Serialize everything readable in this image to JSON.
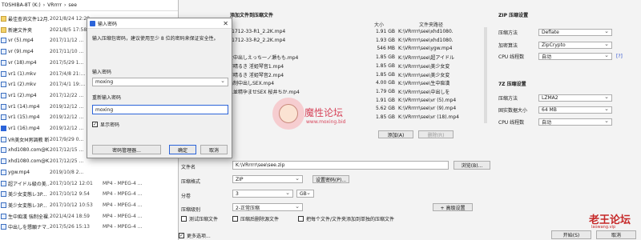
{
  "explorer": {
    "path": [
      "TOSHIBA-8T (K:)",
      "VRrrrr",
      "see"
    ],
    "files": [
      {
        "name": "最佳查询文件12月...",
        "date": "2021/8/24 12:28",
        "type": "",
        "icon": "folder"
      },
      {
        "name": "新建文件夹",
        "date": "2021/8/5 17:58",
        "type": "",
        "icon": "folder"
      },
      {
        "name": "vr (5).mp4",
        "date": "2017/11/12 ...",
        "type": "",
        "icon": "video"
      },
      {
        "name": "vr (9).mp4",
        "date": "2017/11/10 ...",
        "type": "",
        "icon": "video"
      },
      {
        "name": "vr (18).mp4",
        "date": "2017/5/29 1...",
        "type": "",
        "icon": "video"
      },
      {
        "name": "vr1 (1).mkv",
        "date": "2017/4/8 21:...",
        "type": "",
        "icon": "video"
      },
      {
        "name": "vr1 (2).mkv",
        "date": "2017/4/1 19:...",
        "type": "",
        "icon": "video"
      },
      {
        "name": "vr1 (2).mp4",
        "date": "2017/12/22 ...",
        "type": "",
        "icon": "video"
      },
      {
        "name": "vr1 (14).mp4",
        "date": "2019/12/12 ...",
        "type": "",
        "icon": "video"
      },
      {
        "name": "vr1 (15).mp4",
        "date": "2019/12/12 ...",
        "type": "",
        "icon": "video"
      },
      {
        "name": "vr1 (16).mp4",
        "date": "2019/12/12 ...",
        "type": "",
        "icon": "checked"
      },
      {
        "name": "VR美女M男調教 断...",
        "date": "2017/9/29 0...",
        "type": "",
        "icon": "video"
      },
      {
        "name": "xhd1080.com@K...",
        "date": "2017/12/15 ...",
        "type": "",
        "icon": "video"
      },
      {
        "name": "xhd1080.com@K...",
        "date": "2017/12/25 ...",
        "type": "",
        "icon": "video"
      },
      {
        "name": "ygw.mp4",
        "date": "2019/10/8 2...",
        "type": "",
        "icon": "video"
      },
      {
        "name": "超アイドル級の美...",
        "date": "2017/10/12 12:01",
        "type": "MP4 - MPEG-4 ...",
        "icon": "video"
      },
      {
        "name": "美少女変態レ3P...",
        "date": "2017/10/12 9:54",
        "type": "MP4 - MPEG-4 ...",
        "icon": "video"
      },
      {
        "name": "美少女変態レ3P...",
        "date": "2017/10/12 10:53",
        "type": "MP4 - MPEG-4 ...",
        "icon": "video"
      },
      {
        "name": "生中痴漢 強制全裸...",
        "date": "2021/4/24 18:59",
        "type": "MP4 - MPEG-4 ...",
        "icon": "video"
      },
      {
        "name": "中出しを懇願ナマ...",
        "date": "2017/5/26 15:13",
        "type": "MP4 - MPEG-4 ...",
        "icon": "video"
      }
    ]
  },
  "add": {
    "title": "添加文件到压缩文件",
    "col_size": "大小",
    "col_path": "文件夹路径",
    "rows": [
      {
        "name": "R1712-33-R1_2.2K.mp4",
        "size": "1.91 GB",
        "path": "K:\\VRrrrr\\see\\xhd1080."
      },
      {
        "name": "R1712-33-R2_2.2K.mp4",
        "size": "1.93 GB",
        "path": "K:\\VRrrrr\\see\\xhd1080."
      },
      {
        "name": "",
        "size": "546 MB",
        "path": "K:\\VRrrrr\\see\\ygw.mp4"
      },
      {
        "name": "女中出しえっち一ノ瀬もも.mp4",
        "size": "1.85 GB",
        "path": "K:\\VRrrrr\\see\\超アイドル"
      },
      {
        "name": "市晴るき 淫姫琴音1.mp4",
        "size": "1.85 GB",
        "path": "K:\\VRrrrr\\see\\美少女変"
      },
      {
        "name": "市晴るき 淫姫琴音2.mp4",
        "size": "1.85 GB",
        "path": "K:\\VRrrrr\\see\\美少女変"
      },
      {
        "name": "強制中出しSEX.mp4",
        "size": "4.00 GB",
        "path": "K:\\VRrrrr\\see\\生中痴漢"
      },
      {
        "name": "人並精孕ませSEX 桜井ちか.mp4",
        "size": "1.79 GB",
        "path": "K:\\VRrrrr\\see\\中出しを"
      },
      {
        "name": "",
        "size": "1.91 GB",
        "path": "K:\\VRrrrr\\see\\vr (5).mp4"
      },
      {
        "name": "",
        "size": "5.62 GB",
        "path": "K:\\VRrrrr\\see\\vr (9).mp4"
      },
      {
        "name": "",
        "size": "1.85 GB",
        "path": "K:\\VRrrrr\\see\\vr (18).mp4"
      }
    ],
    "add_btn": "添加(A)",
    "remove_btn": "删除(R)",
    "filename_label": "文件名",
    "filename_value": "K:\\VRrrrr\\see\\see.zip",
    "browse_btn": "浏览(B)...",
    "format_label": "压缩格式",
    "format_value": "ZIP",
    "setpw_btn": "设置密码(P)...",
    "volume_label": "分卷",
    "volume_value": "3",
    "volume_unit": "GB",
    "level_label": "压缩级别",
    "level_value": "2-正常压缩",
    "advanced_btn": "+ 高级设置",
    "opt_test": "测试压缩文件",
    "opt_delete": "压缩后删除源文件",
    "opt_each": "把每个文件/文件夹添加到单独的压缩文件",
    "more_options": "更多选项...",
    "start_btn": "开始(S)",
    "cancel_btn": "取消"
  },
  "zip": {
    "title": "ZIP 压缩设置",
    "method_label": "压缩方法",
    "method_value": "Deflate",
    "encrypt_label": "加密算法",
    "encrypt_value": "ZipCrypto",
    "cpu_label": "CPU 线程数",
    "cpu_value": "自动",
    "help": "[?]"
  },
  "sevenz": {
    "title": "7Z 压缩设置",
    "method_label": "压缩方法",
    "method_value": "LZMA2",
    "dict_label": "固实数据大小",
    "dict_value": "64 MB",
    "cpu_label": "CPU 线程数",
    "cpu_value": "自动"
  },
  "dialog": {
    "title": "输入密码",
    "hint": "输入压缩包密码，建议使用至少 8 位的密码来保证安全性。",
    "pw_label": "输入密码",
    "pw_value": "moxing",
    "repeat_label": "重新输入密码",
    "repeat_value": "moxing",
    "show_pw": "显示密码",
    "manager_btn": "密码管理器...",
    "ok_btn": "确定",
    "cancel_btn": "取消",
    "close": "✕"
  },
  "watermark": {
    "text": "魔性论坛",
    "url": "www.moxing.bid"
  },
  "corner": {
    "text": "老王论坛",
    "url": "laowang.vip"
  },
  "colors": {
    "accent": "#2c64d9",
    "link": "#2c4fcf",
    "watermark": "#d7455b",
    "corner": "#c62828"
  }
}
